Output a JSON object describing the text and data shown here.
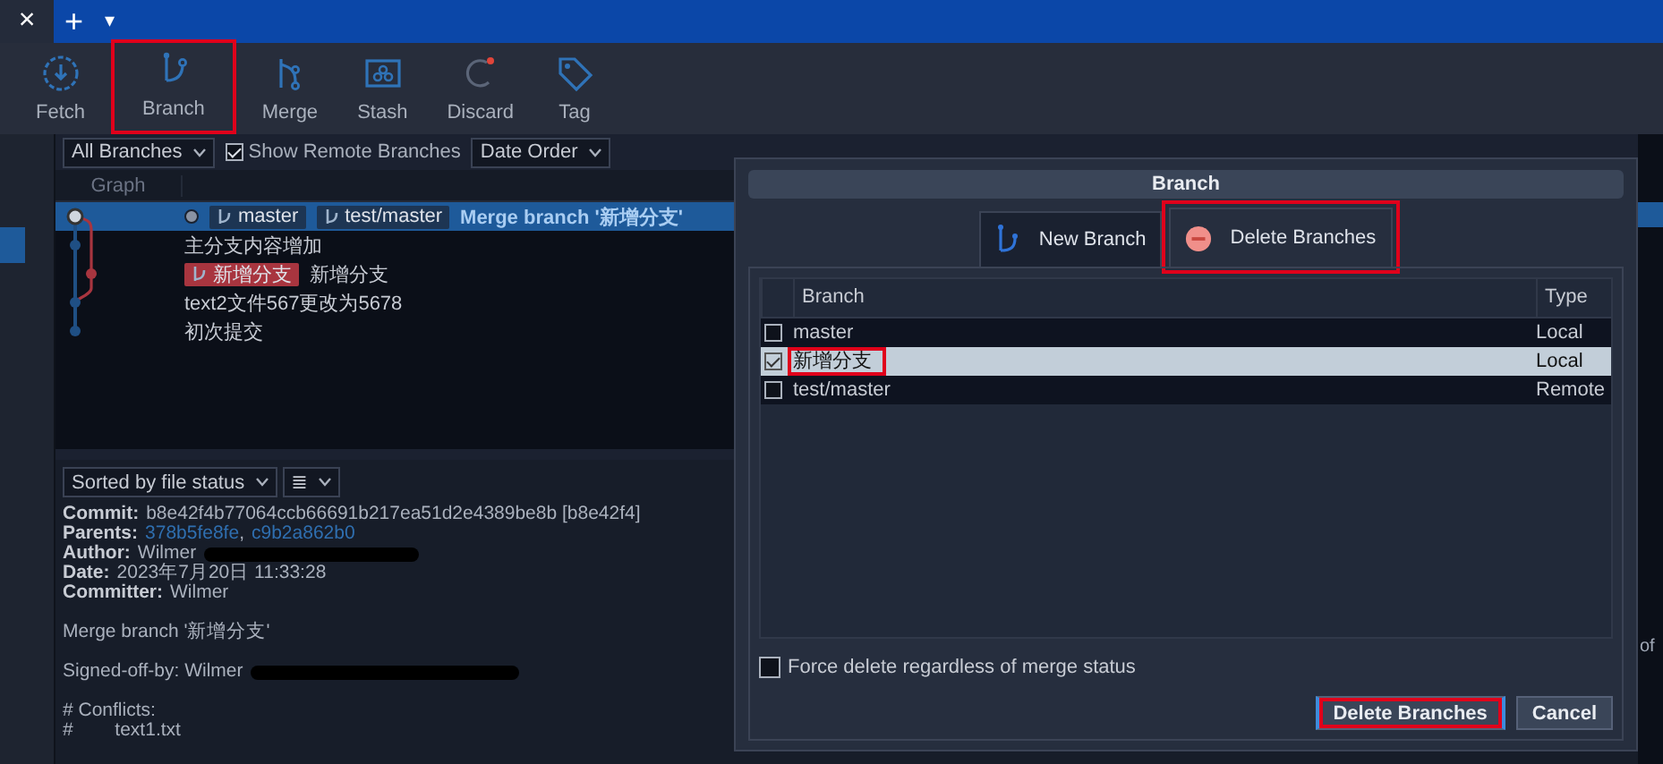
{
  "window": {
    "close_label": "×",
    "new_tab_label": "+",
    "menu_label": "▾"
  },
  "toolbar": [
    {
      "label": "Fetch",
      "kind": "fetch",
      "annotated": false
    },
    {
      "label": "Branch",
      "kind": "branch",
      "annotated": true
    },
    {
      "label": "Merge",
      "kind": "merge",
      "annotated": false
    },
    {
      "label": "Stash",
      "kind": "stash",
      "annotated": false
    },
    {
      "label": "Discard",
      "kind": "discard",
      "annotated": false
    },
    {
      "label": "Tag",
      "kind": "tag",
      "annotated": false
    }
  ],
  "filters": {
    "branches": "All Branches",
    "show_remote": {
      "label": "Show Remote Branches",
      "checked": true
    },
    "order": "Date Order"
  },
  "graph": {
    "header": "Graph",
    "commits": [
      {
        "message": "Merge branch '新增分支'",
        "selected": true,
        "head": true,
        "refs": [
          {
            "name": "master",
            "color": "#1d3553"
          },
          {
            "name": "test/master",
            "color": "#1d3553"
          }
        ]
      },
      {
        "message": "主分支内容增加",
        "selected": false,
        "head": false
      },
      {
        "message": "新增分支",
        "selected": false,
        "head": false,
        "refs": [
          {
            "name": "新增分支",
            "color": "#a8353f"
          }
        ]
      },
      {
        "message": "text2文件567更改为5678",
        "selected": false,
        "head": false
      },
      {
        "message": "初次提交",
        "selected": false,
        "head": false
      }
    ]
  },
  "details": {
    "sort": "Sorted by file status",
    "view_menu": "≣",
    "fields": [
      {
        "label": "Commit:",
        "value": "b8e42f4b77064ccb66691b217ea51d2e4389be8b [b8e42f4]",
        "redacted": false
      },
      {
        "label": "Parents:",
        "links": [
          "378b5fe8fe",
          "c9b2a862b0"
        ],
        "separator": ",",
        "redacted": false
      },
      {
        "label": "Author:",
        "value": "Wilmer",
        "redacted": true
      },
      {
        "label": "Date:",
        "value": "2023年7月20日 11:33:28",
        "redacted": false
      },
      {
        "label": "Committer:",
        "value": "Wilmer",
        "redacted": false
      }
    ],
    "message": [
      {
        "lines": [
          "Merge branch '新增分支'"
        ],
        "redacted": false
      },
      {
        "lines": [
          "Signed-off-by: Wilmer"
        ],
        "redacted": true
      },
      {
        "lines": [
          "# Conflicts:",
          "#        text1.txt"
        ],
        "redacted": false
      }
    ]
  },
  "side_text": "of",
  "dialog": {
    "title": "Branch",
    "tabs": [
      {
        "label": "New Branch",
        "kind": "new",
        "selected": false,
        "annotated": false
      },
      {
        "label": "Delete Branches",
        "kind": "delete",
        "selected": true,
        "annotated": true
      }
    ],
    "columns": [
      "Branch",
      "Type"
    ],
    "branches": [
      {
        "name": "master",
        "type": "Local",
        "checked": false,
        "selected": false,
        "annotated": false
      },
      {
        "name": "新增分支",
        "type": "Local",
        "checked": true,
        "selected": true,
        "annotated": true
      },
      {
        "name": "test/master",
        "type": "Remote",
        "checked": false,
        "selected": false,
        "annotated": false
      }
    ],
    "force_delete": {
      "label": "Force delete regardless of merge status",
      "checked": false
    },
    "buttons": [
      {
        "label": "Delete Branches",
        "default": true,
        "annotated": true
      },
      {
        "label": "Cancel",
        "default": false,
        "annotated": false
      }
    ]
  }
}
